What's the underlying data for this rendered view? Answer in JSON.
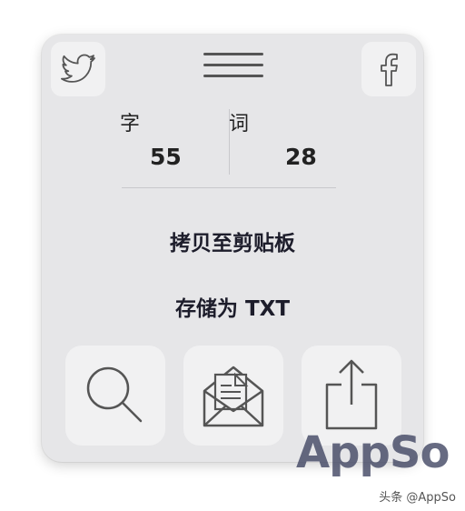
{
  "header": {
    "twitter_icon": "twitter-bird-icon",
    "menu_icon": "hamburger-menu-icon",
    "facebook_icon": "facebook-f-icon"
  },
  "stats": {
    "characters_label": "字",
    "characters_value": "55",
    "words_label": "词",
    "words_value": "28"
  },
  "actions": {
    "copy_label": "拷贝至剪贴板",
    "save_label": "存储为 TXT"
  },
  "tiles": [
    "search-icon",
    "mail-icon",
    "share-icon"
  ],
  "watermark": {
    "logo_text": "AppSo",
    "credit": "头条 @AppSo"
  }
}
